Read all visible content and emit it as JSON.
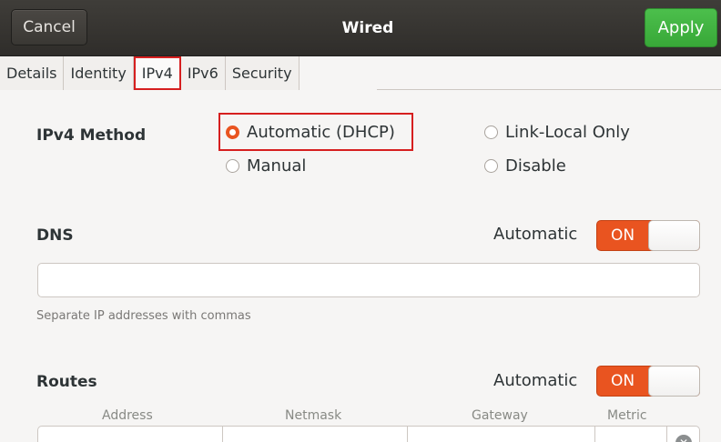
{
  "header": {
    "cancel_label": "Cancel",
    "title": "Wired",
    "apply_label": "Apply"
  },
  "tabs": [
    {
      "label": "Details"
    },
    {
      "label": "Identity"
    },
    {
      "label": "IPv4",
      "active": true
    },
    {
      "label": "IPv6"
    },
    {
      "label": "Security"
    }
  ],
  "ipv4": {
    "method_label": "IPv4 Method",
    "options": {
      "automatic": {
        "label": "Automatic (DHCP)",
        "checked": true
      },
      "link_local": {
        "label": "Link-Local Only",
        "checked": false
      },
      "manual": {
        "label": "Manual",
        "checked": false
      },
      "disable": {
        "label": "Disable",
        "checked": false
      }
    }
  },
  "dns": {
    "label": "DNS",
    "automatic_label": "Automatic",
    "switch_label": "ON",
    "value": "",
    "hint": "Separate IP addresses with commas"
  },
  "routes": {
    "label": "Routes",
    "automatic_label": "Automatic",
    "switch_label": "ON",
    "columns": {
      "address": "Address",
      "netmask": "Netmask",
      "gateway": "Gateway",
      "metric": "Metric"
    }
  },
  "colors": {
    "accent": "#e95420",
    "apply": "#3cb03c",
    "highlight": "#d61f1f"
  },
  "icons": {
    "delete_row": "clear-icon"
  }
}
